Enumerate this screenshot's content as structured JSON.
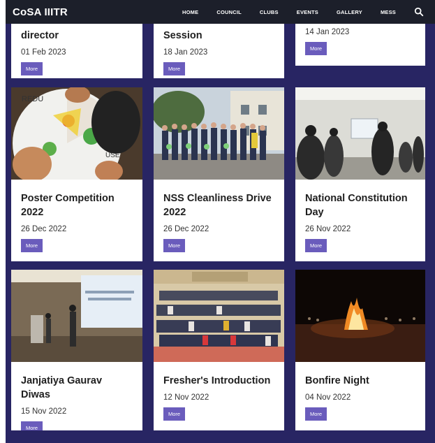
{
  "nav": {
    "brand": "CoSA IIITR",
    "links": [
      "HOME",
      "COUNCIL",
      "CLUBS",
      "EVENTS",
      "GALLERY",
      "MESS"
    ]
  },
  "colors": {
    "navbar": "#1c1f2a",
    "background": "#282563",
    "button": "#6a5cbc"
  },
  "top_cards": [
    {
      "title": "director",
      "date": "01 Feb 2023",
      "button": "More"
    },
    {
      "title": "Session",
      "date": "18 Jan 2023",
      "button": "More"
    },
    {
      "title": "",
      "date": "14 Jan 2023",
      "button": "More"
    }
  ],
  "cards": [
    {
      "title": "Poster Competition 2022",
      "date": "26 Dec 2022",
      "button": "More",
      "image": "poster-competition-photo"
    },
    {
      "title": "NSS Cleanliness Drive 2022",
      "date": "26 Dec 2022",
      "button": "More",
      "image": "cleanliness-drive-photo"
    },
    {
      "title": "National Constitution Day",
      "date": "26 Nov 2022",
      "button": "More",
      "image": "constitution-day-photo"
    },
    {
      "title": "Janjatiya Gaurav Diwas",
      "date": "15 Nov 2022",
      "button": "More",
      "image": "gaurav-diwas-photo"
    },
    {
      "title": "Fresher's Introduction",
      "date": "12 Nov 2022",
      "button": "More",
      "image": "freshers-introduction-photo"
    },
    {
      "title": "Bonfire Night",
      "date": "04 Nov 2022",
      "button": "More",
      "image": "bonfire-night-photo"
    }
  ]
}
